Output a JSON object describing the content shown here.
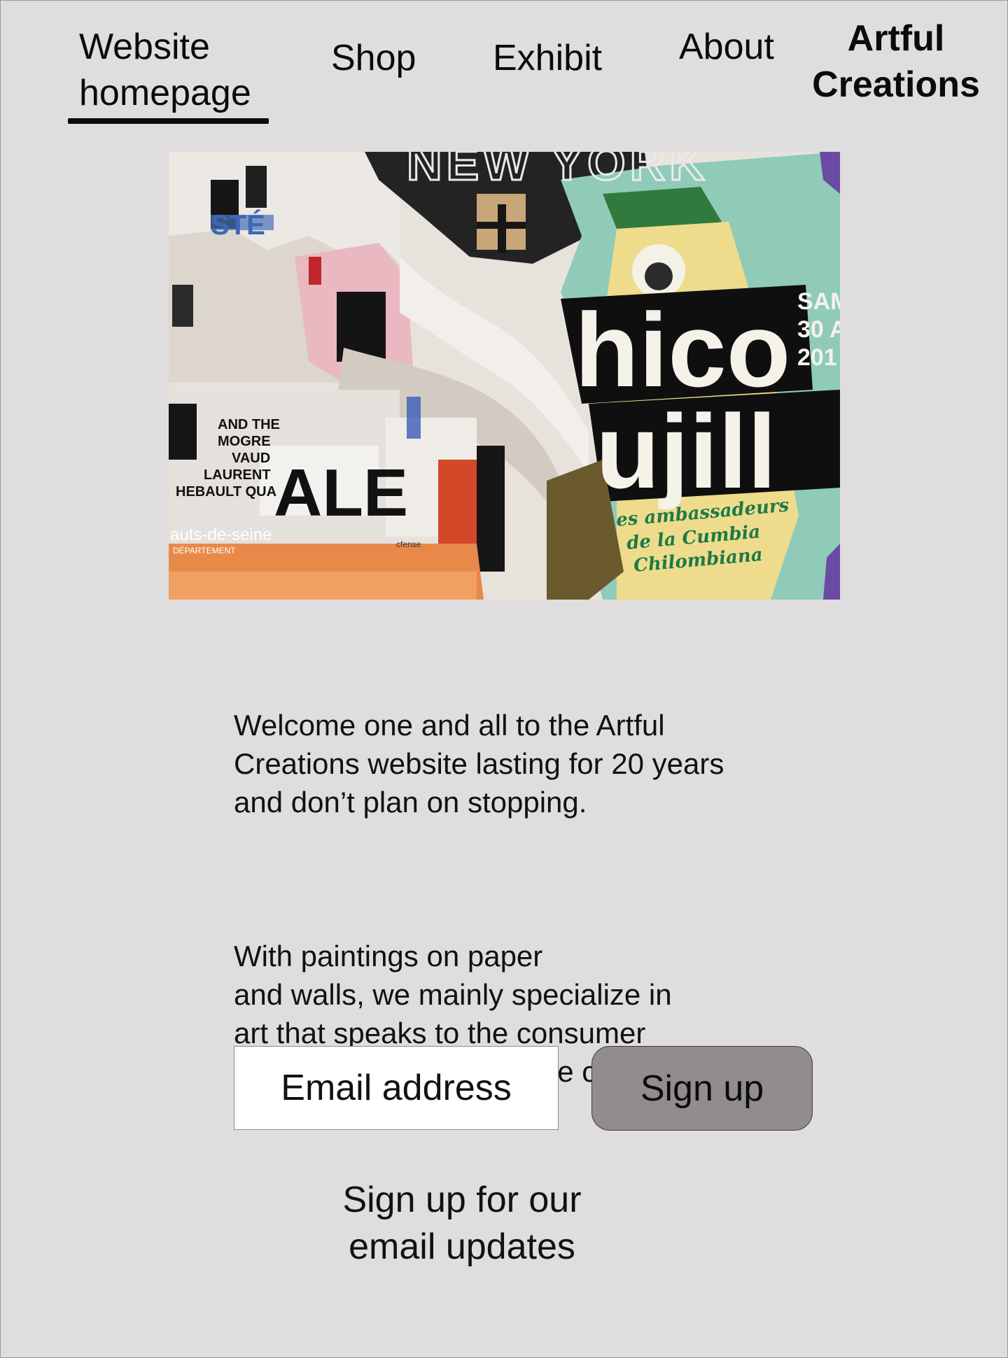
{
  "nav": {
    "home_label": "Website homepage",
    "shop_label": "Shop",
    "exhibit_label": "Exhibit",
    "about_label": "About"
  },
  "brand": {
    "name": "Artful Creations"
  },
  "hero": {
    "poster_texts": {
      "new_york": "NEW YORK",
      "chico": "hico",
      "trujillo": "ujill",
      "ambassadeurs_1": "es ambassadeurs",
      "ambassadeurs_2": "de la Cumbia",
      "ambassadeurs_3": "Chilombiana",
      "date_1": "SAM",
      "date_2": "30 A",
      "date_3": "201",
      "sale": "ALE",
      "hauts_de_seine": "auts-de-seine",
      "departement": "DÉPARTEMENT",
      "laurent": "LAURENT",
      "thebault": "HEBAULT QUA",
      "mogre": "MOGRE",
      "vaud": "VAUD",
      "and_the": "AND THE",
      "ste": "STÉ",
      "cfense": "cfense"
    }
  },
  "intro": {
    "paragraph_1": "Welcome one and all to the Artful\nCreations website lasting for 20 years\n and don’t plan on stopping.",
    "paragraph_2": "With paintings on paper\nand walls, we mainly specialize in\nart that speaks to the consumer\nand deliver as soon as we can."
  },
  "signup": {
    "email_placeholder": "Email address",
    "button_label": "Sign up",
    "caption": "Sign up for our\n email updates"
  },
  "colors": {
    "background": "#dfdddd",
    "button": "#918d8d",
    "text": "#0b0b0b",
    "poster_teal": "#8fcbb8",
    "poster_yellow": "#eedc8c",
    "poster_green_text": "#1f7a4a"
  }
}
